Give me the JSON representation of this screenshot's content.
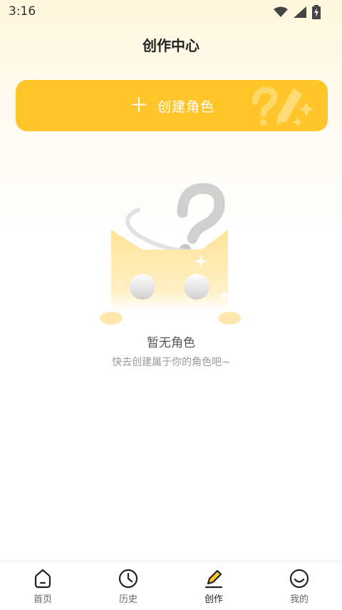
{
  "status_bar": {
    "time": "3:16"
  },
  "header": {
    "title": "创作中心"
  },
  "create_button": {
    "label": "创建角色"
  },
  "empty_state": {
    "title": "暂无角色",
    "subtitle": "快去创建属于你的角色吧~"
  },
  "tabbar": {
    "items": [
      {
        "label": "首页",
        "icon": "home-icon"
      },
      {
        "label": "历史",
        "icon": "clock-icon"
      },
      {
        "label": "创作",
        "icon": "pencil-icon"
      },
      {
        "label": "我的",
        "icon": "smile-icon"
      }
    ],
    "active": "创作"
  },
  "colors": {
    "accent": "#ffc52a",
    "background_top": "#fff7dd"
  }
}
